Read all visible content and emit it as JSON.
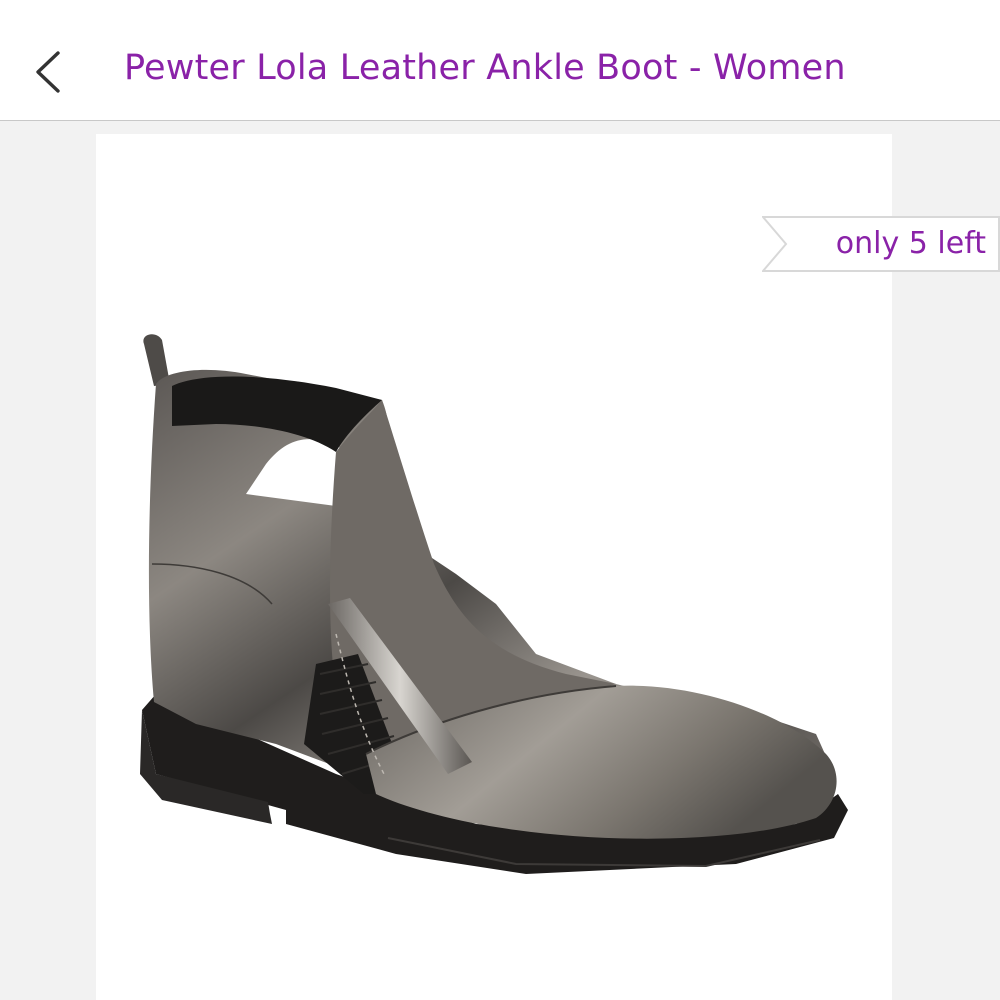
{
  "header": {
    "back_icon": "chevron-left-icon",
    "title": "Pewter Lola Leather Ankle Boot - Women"
  },
  "product": {
    "image_subject": "pewter-ankle-boot-image",
    "stock_badge": "only 5 left"
  },
  "colors": {
    "accent": "#8a22a8",
    "icon": "#333333",
    "divider": "#c8c8c8",
    "page_bg": "#f2f2f2",
    "card_bg": "#ffffff"
  }
}
